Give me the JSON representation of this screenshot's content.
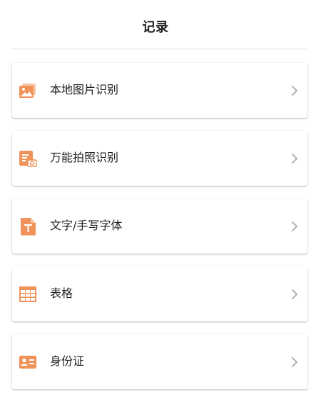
{
  "header": {
    "title": "记录"
  },
  "accent_color": "#f0935a",
  "items": [
    {
      "label": "本地图片识别",
      "icon": "image-icon"
    },
    {
      "label": "万能拍照识别",
      "icon": "camera-doc-icon"
    },
    {
      "label": "文字/手写字体",
      "icon": "text-doc-icon"
    },
    {
      "label": "表格",
      "icon": "table-icon"
    },
    {
      "label": "身份证",
      "icon": "id-card-icon"
    }
  ]
}
